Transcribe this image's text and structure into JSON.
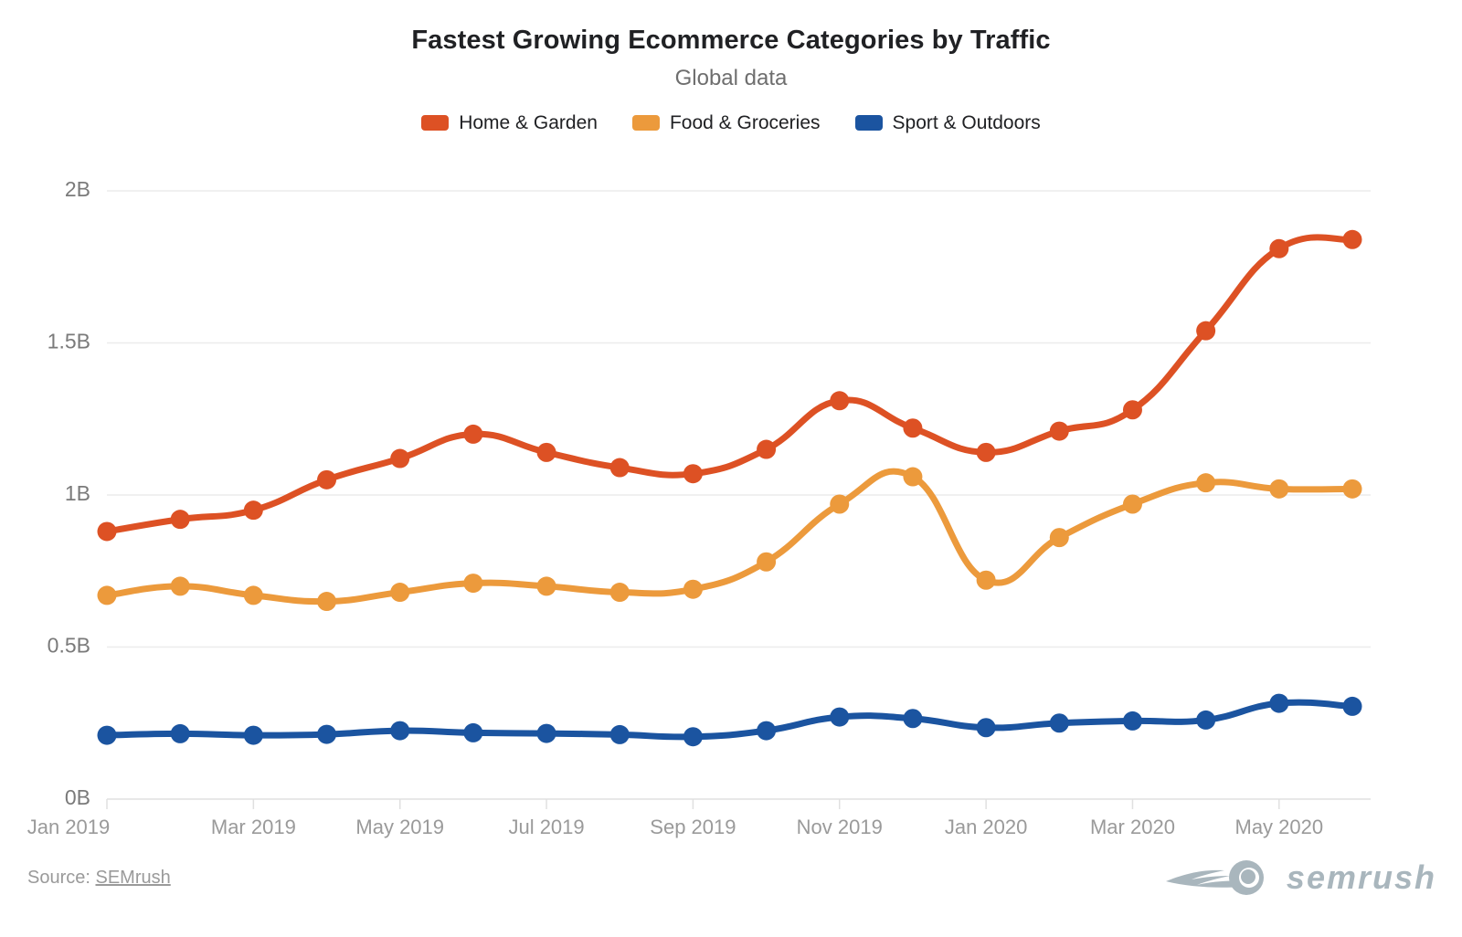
{
  "header": {
    "title": "Fastest Growing Ecommerce Categories by Traffic",
    "subtitle": "Global data"
  },
  "legend": {
    "items": [
      {
        "label": "Home & Garden",
        "color": "#DD5124"
      },
      {
        "label": "Food & Groceries",
        "color": "#EC9A3C"
      },
      {
        "label": "Sport & Outdoors",
        "color": "#1B54A0"
      }
    ]
  },
  "footer": {
    "source_prefix": "Source: ",
    "source_name": "SEMrush",
    "brand_name": "semrush",
    "brand_icon": "comet-icon"
  },
  "chart_data": {
    "type": "line",
    "title": "Fastest Growing Ecommerce Categories by Traffic",
    "subtitle": "Global data",
    "xlabel": "",
    "ylabel": "",
    "ylim": [
      0,
      2
    ],
    "yunit": "B",
    "ytick_labels": [
      "2B",
      "1.5B",
      "1B",
      "0.5B",
      "0B"
    ],
    "ytick_values": [
      2,
      1.5,
      1,
      0.5,
      0
    ],
    "grid": true,
    "legend_position": "top-center",
    "x": [
      "Jan 2019",
      "Feb 2019",
      "Mar 2019",
      "Apr 2019",
      "May 2019",
      "Jun 2019",
      "Jul 2019",
      "Aug 2019",
      "Sep 2019",
      "Oct 2019",
      "Nov 2019",
      "Dec 2019",
      "Jan 2020",
      "Feb 2020",
      "Mar 2020",
      "Apr 2020",
      "May 2020",
      "Jun 2020"
    ],
    "xtick_labels": [
      "Jan 2019",
      "Mar 2019",
      "May 2019",
      "Jul 2019",
      "Sep 2019",
      "Nov 2019",
      "Jan 2020",
      "Mar 2020",
      "May 2020"
    ],
    "series": [
      {
        "name": "Home & Garden",
        "color": "#DD5124",
        "values": [
          0.88,
          0.92,
          0.95,
          1.05,
          1.12,
          1.2,
          1.14,
          1.09,
          1.07,
          1.15,
          1.31,
          1.22,
          1.14,
          1.21,
          1.28,
          1.54,
          1.81,
          1.84
        ]
      },
      {
        "name": "Food & Groceries",
        "color": "#EC9A3C",
        "values": [
          0.67,
          0.7,
          0.67,
          0.65,
          0.68,
          0.71,
          0.7,
          0.68,
          0.69,
          0.78,
          0.97,
          1.06,
          0.72,
          0.86,
          0.97,
          1.04,
          1.02,
          1.02
        ]
      },
      {
        "name": "Sport & Outdoors",
        "color": "#1B54A0",
        "values": [
          0.21,
          0.215,
          0.21,
          0.213,
          0.225,
          0.218,
          0.216,
          0.212,
          0.205,
          0.225,
          0.27,
          0.265,
          0.235,
          0.25,
          0.257,
          0.26,
          0.315,
          0.305
        ]
      }
    ]
  }
}
